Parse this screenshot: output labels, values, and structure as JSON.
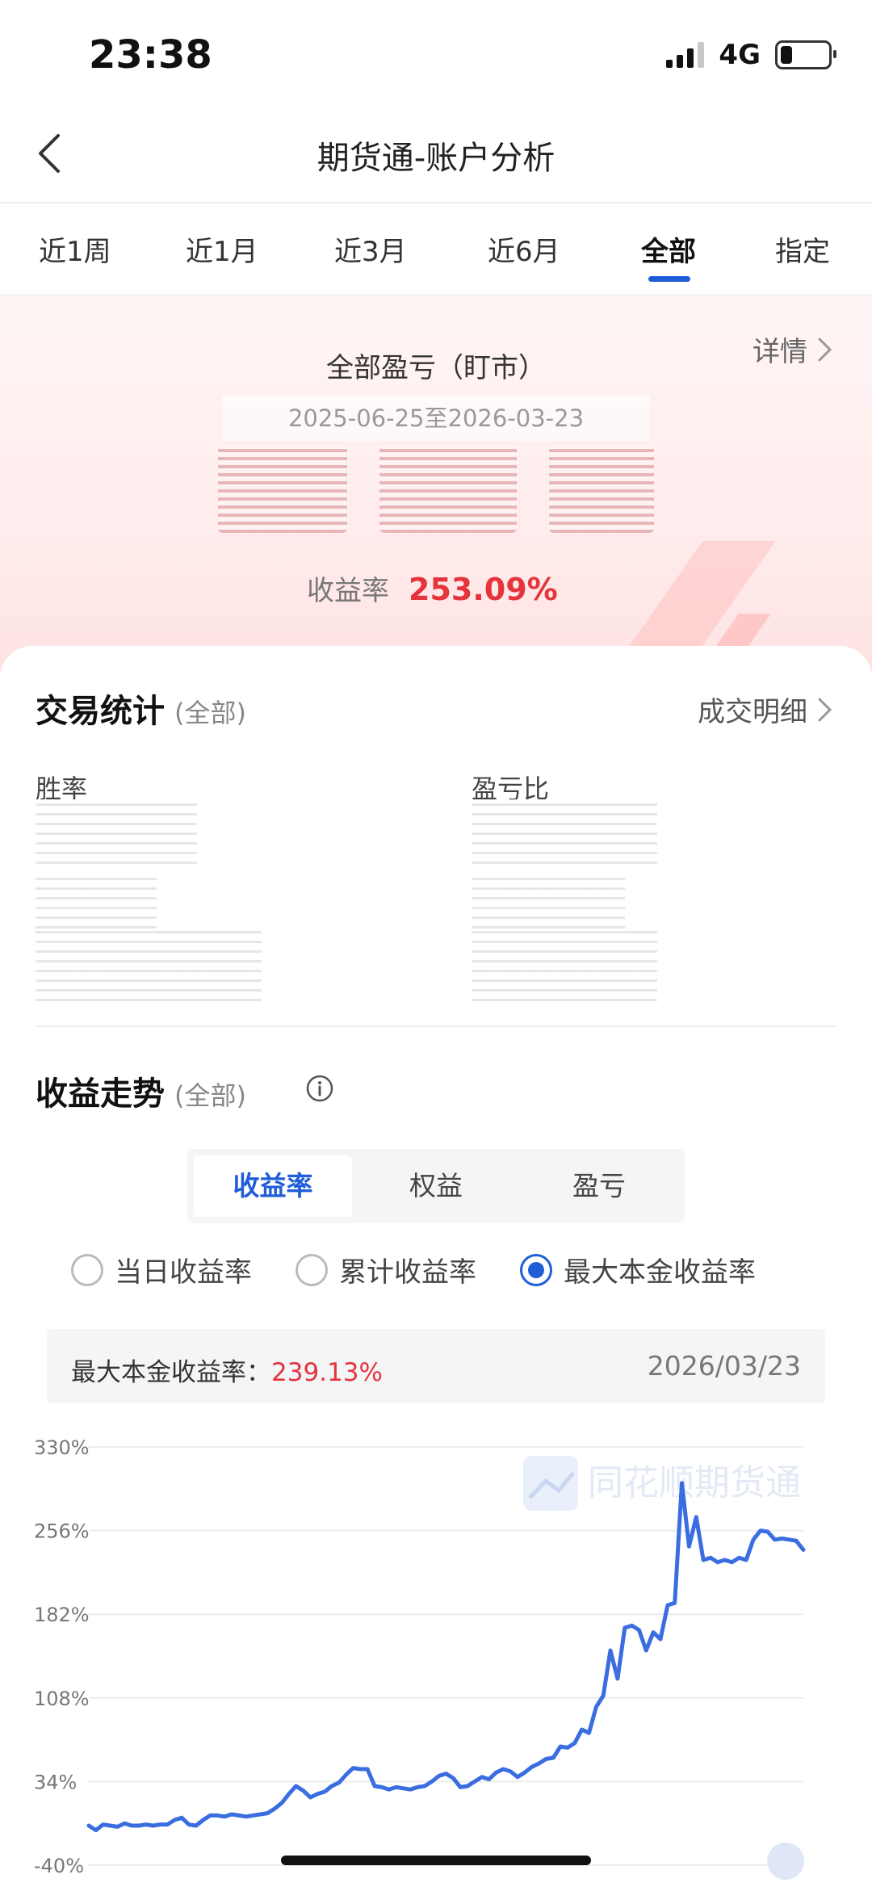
{
  "status_bar": {
    "time": "23:38",
    "network": "4G"
  },
  "header": {
    "title": "期货通-账户分析"
  },
  "tabs": [
    {
      "label": "近1周",
      "active": false
    },
    {
      "label": "近1月",
      "active": false
    },
    {
      "label": "近3月",
      "active": false
    },
    {
      "label": "近6月",
      "active": false
    },
    {
      "label": "全部",
      "active": true
    },
    {
      "label": "指定",
      "active": false
    }
  ],
  "summary": {
    "title": "全部盈亏（盯市）",
    "detail_link": "详情",
    "date_range": "2025-06-25至2026-03-23",
    "return_label": "收益率",
    "return_value": "253.09%"
  },
  "trade_stats": {
    "title": "交易统计",
    "scope": "(全部)",
    "detail_link": "成交明细",
    "win_rate_label": "胜率",
    "profit_loss_ratio_label": "盈亏比"
  },
  "trend": {
    "title": "收益走势",
    "scope": "(全部)",
    "segments": [
      {
        "label": "收益率",
        "active": true
      },
      {
        "label": "权益",
        "active": false
      },
      {
        "label": "盈亏",
        "active": false
      }
    ],
    "radios": [
      {
        "label": "当日收益率",
        "checked": false
      },
      {
        "label": "累计收益率",
        "checked": false
      },
      {
        "label": "最大本金收益率",
        "checked": true
      }
    ],
    "info": {
      "label": "最大本金收益率：",
      "value": "239.13%",
      "date": "2026/03/23"
    },
    "watermark": "同花顺期货通"
  },
  "colors": {
    "accent": "#1f5ed8",
    "positive": "#e5343b",
    "line": "#3a6ee0"
  },
  "chart_data": {
    "type": "line",
    "title": "",
    "xlabel": "",
    "ylabel": "",
    "ylim": [
      -40,
      330
    ],
    "y_ticks": [
      "330%",
      "256%",
      "182%",
      "108%",
      "34%",
      "-40%"
    ],
    "y_tick_values": [
      330,
      256,
      182,
      108,
      34,
      -40
    ],
    "series": [
      {
        "values": [
          -5,
          -9,
          -4,
          -5,
          -6,
          -3,
          -5,
          -5,
          -4,
          -5,
          -4,
          -4,
          0,
          2,
          -4,
          -5,
          0,
          4,
          4,
          3,
          5,
          4,
          3,
          4,
          5,
          6,
          10,
          15,
          23,
          30,
          26,
          20,
          23,
          25,
          30,
          33,
          40,
          46,
          45,
          45,
          30,
          29,
          27,
          29,
          28,
          27,
          29,
          30,
          34,
          39,
          41,
          37,
          29,
          30,
          34,
          38,
          36,
          42,
          45,
          43,
          38,
          42,
          47,
          50,
          54,
          55,
          65,
          64,
          68,
          80,
          77,
          100,
          110,
          150,
          125,
          170,
          172,
          168,
          150,
          166,
          160,
          190,
          192,
          298,
          242,
          268,
          230,
          232,
          228,
          230,
          228,
          232,
          230,
          248,
          256,
          255,
          248,
          249,
          248,
          247,
          239
        ]
      }
    ]
  }
}
